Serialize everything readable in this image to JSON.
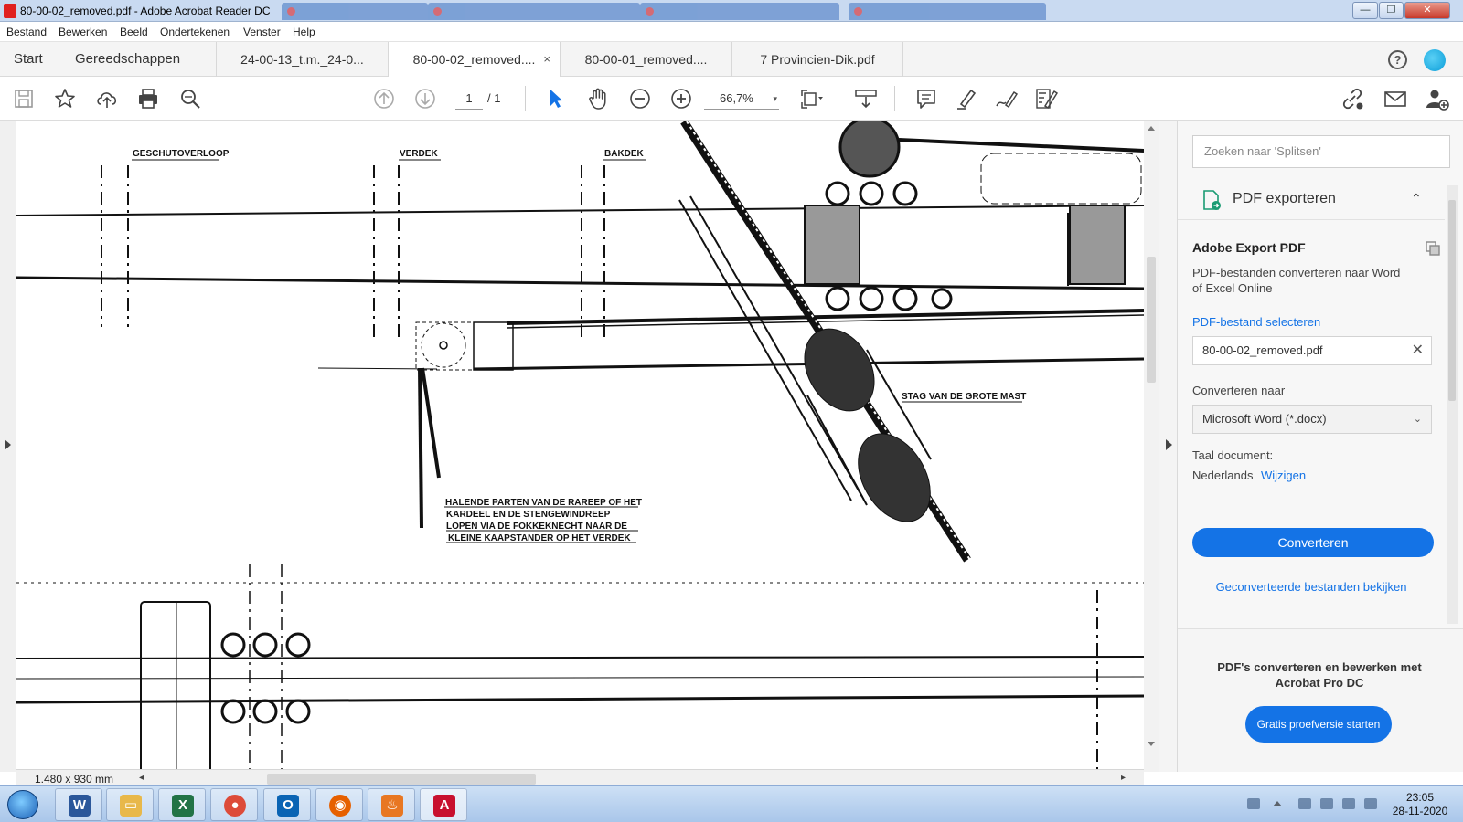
{
  "window": {
    "title": "80-00-02_removed.pdf - Adobe Acrobat Reader DC",
    "controls": {
      "minimize": "—",
      "maximize": "❐",
      "close": "✕"
    }
  },
  "menu": [
    "Bestand",
    "Bewerken",
    "Beeld",
    "Ondertekenen",
    "Venster",
    "Help"
  ],
  "tabs": {
    "start": "Start",
    "tools": "Gereedschappen",
    "documents": [
      {
        "label": "24-00-13_t.m._24-0...",
        "active": false
      },
      {
        "label": "80-00-02_removed....",
        "active": true,
        "close": "×"
      },
      {
        "label": "80-00-01_removed....",
        "active": false
      },
      {
        "label": "7 Provincien-Dik.pdf",
        "active": false
      }
    ],
    "help": "?"
  },
  "toolbar": {
    "page_current": "1",
    "page_total": "/ 1",
    "zoom": "66,7%",
    "zoom_caret": "▾"
  },
  "drawing": {
    "labels": {
      "geschutoverloop": "GESCHUTOVERLOOP",
      "verdek": "VERDEK",
      "bakdek": "BAKDEK",
      "stag": "STAG VAN DE GROTE MAST",
      "note_line1": "HALENDE PARTEN VAN DE RAREEP OF HET",
      "note_line2": "KARDEEL EN DE STENGEWINDREEP",
      "note_line3": "LOPEN VIA DE FOKKEKNECHT NAAR DE",
      "note_line4": "KLEINE KAAPSTANDER OP HET VERDEK"
    }
  },
  "status": {
    "page_size": "1.480 x 930 mm",
    "scroll_left": "◂",
    "scroll_right": "▸"
  },
  "panel": {
    "search_placeholder": "Zoeken naar 'Splitsen'",
    "export_title": "PDF exporteren",
    "collapse": "⌃",
    "service_title": "Adobe Export PDF",
    "description_line1": "PDF-bestanden converteren naar Word",
    "description_line2": "of Excel Online",
    "select_link": "PDF-bestand selecteren",
    "file_name": "80-00-02_removed.pdf",
    "clear_file": "✕",
    "convert_to_label": "Converteren naar",
    "convert_to_value": "Microsoft Word (*.docx)",
    "language_label": "Taal document:",
    "language_value": "Nederlands",
    "language_change": "Wijzigen",
    "convert_button": "Converteren",
    "view_converted": "Geconverteerde bestanden bekijken",
    "promo_text": "PDF's converteren en bewerken met Acrobat Pro DC",
    "trial_button": "Gratis proefversie starten"
  },
  "taskbar": {
    "apps": [
      {
        "name": "word",
        "glyph": "W",
        "color": "#2b579a"
      },
      {
        "name": "explorer",
        "glyph": "▭",
        "color": "#e8b84a"
      },
      {
        "name": "excel",
        "glyph": "X",
        "color": "#217346"
      },
      {
        "name": "chrome",
        "glyph": "●",
        "color": "#dd4b39"
      },
      {
        "name": "outlook",
        "glyph": "O",
        "color": "#0a64b4"
      },
      {
        "name": "firefox",
        "glyph": "◉",
        "color": "#e66000"
      },
      {
        "name": "other",
        "glyph": "♨",
        "color": "#e87722"
      },
      {
        "name": "acrobat",
        "glyph": "A",
        "color": "#c8102e"
      }
    ],
    "time": "23:05",
    "date": "28-11-2020"
  }
}
